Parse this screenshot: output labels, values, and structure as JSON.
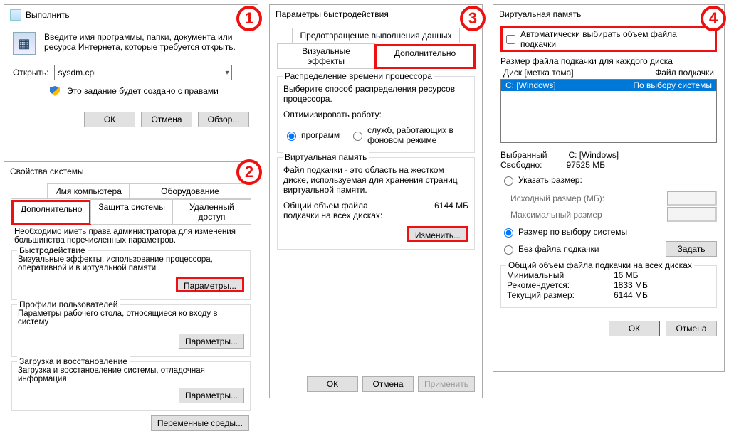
{
  "run": {
    "title": "Выполнить",
    "desc": "Введите имя программы, папки, документа или ресурса Интернета, которые требуется открыть.",
    "open_label": "Открыть:",
    "open_value": "sysdm.cpl",
    "admin_note": "Это задание будет создано с правами",
    "ok": "ОК",
    "cancel": "Отмена",
    "browse": "Обзор..."
  },
  "sysprop": {
    "title": "Свойства системы",
    "tabs": {
      "name": "Имя компьютера",
      "hardware": "Оборудование",
      "advanced": "Дополнительно",
      "protection": "Защита системы",
      "remote": "Удаленный доступ"
    },
    "admin_note": "Необходимо иметь права администратора для изменения большинства перечисленных параметров.",
    "perf_title": "Быстродействие",
    "perf_desc": "Визуальные эффекты, использование процессора, оперативной и в иртуальной памяти",
    "profiles_title": "Профили пользователей",
    "profiles_desc": "Параметры рабочего стола, относящиеся ко входу в систему",
    "startup_title": "Загрузка и восстановление",
    "startup_desc": "Загрузка и восстановление системы, отладочная информация",
    "params_btn": "Параметры...",
    "env_btn": "Переменные среды..."
  },
  "perf": {
    "title": "Параметры быстродействия",
    "tabs": {
      "visual": "Визуальные эффекты",
      "advanced": "Дополнительно",
      "dep": "Предотвращение выполнения данных"
    },
    "sched_title": "Распределение времени процессора",
    "sched_desc": "Выберите способ распределения ресурсов процессора.",
    "opt_label": "Оптимизировать работу:",
    "opt_programs": "программ",
    "opt_services": "служб, работающих в фоновом режиме",
    "vm_title": "Виртуальная память",
    "vm_desc": "Файл подкачки - это область на жестком диске, используемая для хранения страниц виртуальной памяти.",
    "vm_total_label": "Общий объем файла подкачки на всех дисках:",
    "vm_total_value": "6144 МБ",
    "change_btn": "Изменить...",
    "ok": "ОК",
    "cancel": "Отмена",
    "apply": "Применить"
  },
  "vm": {
    "title": "Виртуальная память",
    "auto_check": "Автоматически выбирать объем файла подкачки",
    "each_label": "Размер файла подкачки для каждого диска",
    "col_drive": "Диск [метка тома]",
    "col_page": "Файл подкачки",
    "row_drive": "C:     [Windows]",
    "row_page": "По выбору системы",
    "selected_label": "Выбранный",
    "selected_value": "C:  [Windows]",
    "free_label": "Свободно:",
    "free_value": "97525 МБ",
    "custom_label": "Указать размер:",
    "init_label": "Исходный размер (МБ):",
    "max_label": "Максимальный размер",
    "system_label": "Размер по выбору системы",
    "none_label": "Без файла подкачки",
    "set_btn": "Задать",
    "totals_title": "Общий объем файла подкачки на всех дисках",
    "min_label": "Минимальный",
    "min_value": "16 МБ",
    "rec_label": "Рекомендуется:",
    "rec_value": "1833 МБ",
    "cur_label": "Текущий размер:",
    "cur_value": "6144 МБ",
    "ok": "ОК",
    "cancel": "Отмена"
  },
  "badges": {
    "1": "1",
    "2": "2",
    "3": "3",
    "4": "4"
  }
}
